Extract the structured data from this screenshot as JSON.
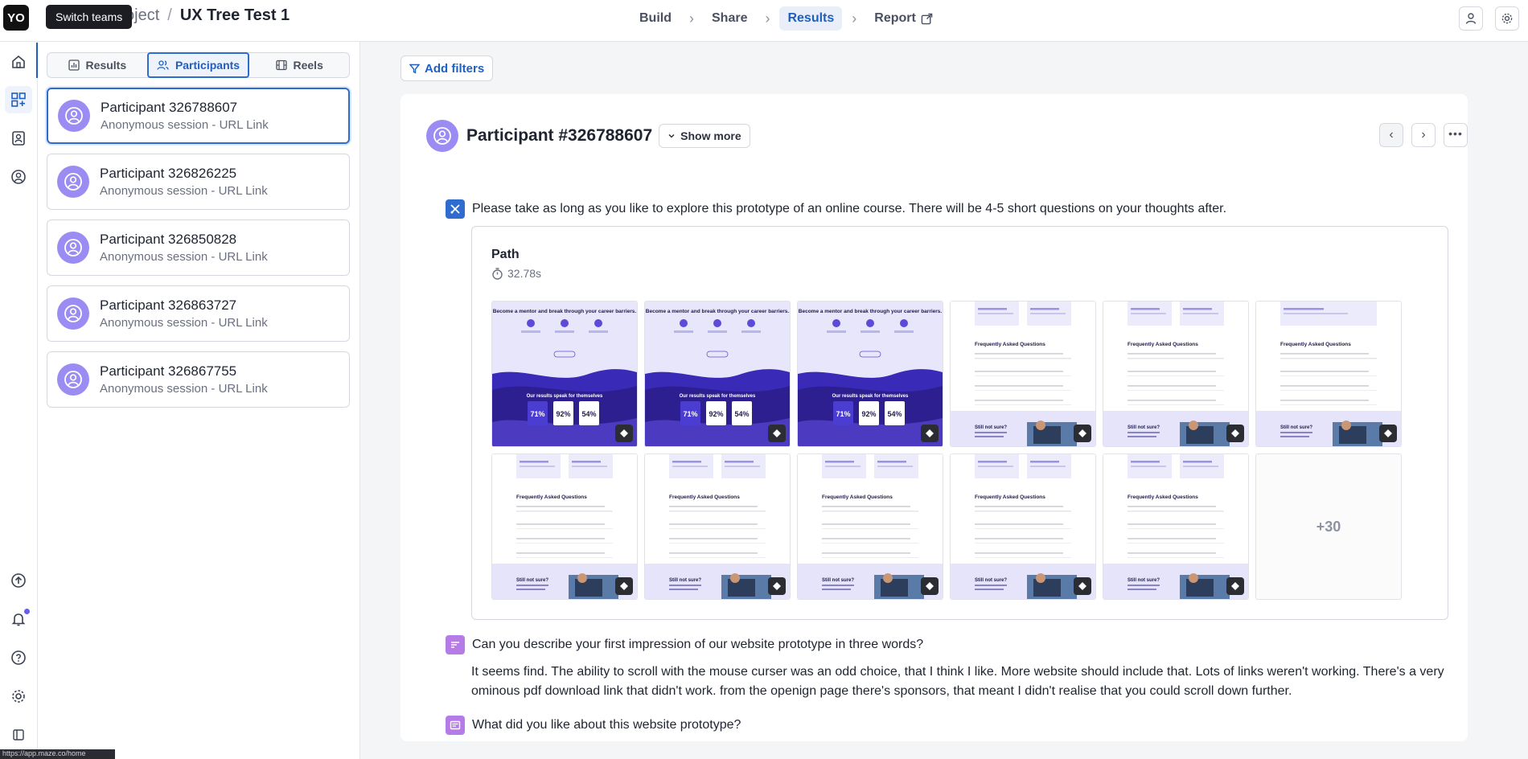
{
  "header": {
    "team_badge": "YO",
    "tooltip": "Switch teams",
    "project_crumb": "oject",
    "separator": "/",
    "test_name": "UX Tree Test 1",
    "steps": [
      {
        "label": "Build"
      },
      {
        "label": "Share"
      },
      {
        "label": "Results"
      },
      {
        "label": "Report"
      }
    ],
    "active_step": "Results"
  },
  "panel": {
    "tabs": [
      {
        "label": "Results"
      },
      {
        "label": "Participants"
      },
      {
        "label": "Reels"
      }
    ],
    "active_tab": "Participants",
    "participants": [
      {
        "name": "Participant 326788607",
        "session": "Anonymous session - URL Link"
      },
      {
        "name": "Participant 326826225",
        "session": "Anonymous session - URL Link"
      },
      {
        "name": "Participant 326850828",
        "session": "Anonymous session - URL Link"
      },
      {
        "name": "Participant 326863727",
        "session": "Anonymous session - URL Link"
      },
      {
        "name": "Participant 326867755",
        "session": "Anonymous session - URL Link"
      }
    ]
  },
  "main": {
    "add_filters": "Add filters",
    "participant_title": "Participant #326788607",
    "show_more": "Show more",
    "task1": {
      "prompt": "Please take as long as you like to explore this prototype of an online course. There will be 4-5 short questions on your thoughts after.",
      "path_title": "Path",
      "path_duration": "32.78s",
      "more_count": "+30"
    },
    "q1": {
      "prompt": "Can you describe your first impression of our website prototype in three words?",
      "answer": "It seems find. The ability to scroll with the mouse curser was an odd choice, that I think I like. More website should include that. Lots of links weren't working. There's a very ominous pdf download link that didn't work. from the openign page there's sponsors, that meant I didn't realise that you could scroll down further."
    },
    "q2": {
      "prompt": "What did you like about this website prototype?"
    },
    "thumb_text": {
      "hero_heading": "Become a mentor and break through your career barriers.",
      "results_heading": "Our results speak for themselves",
      "stats": [
        "71%",
        "92%",
        "54%"
      ],
      "faq_heading": "Frequently Asked Questions",
      "not_sure": "Still not sure?"
    }
  },
  "status_url": "https://app.maze.co/home",
  "colors": {
    "accent": "#1f5fbf",
    "avatar": "#9b8cf3",
    "hero": "#2d1f8f"
  }
}
